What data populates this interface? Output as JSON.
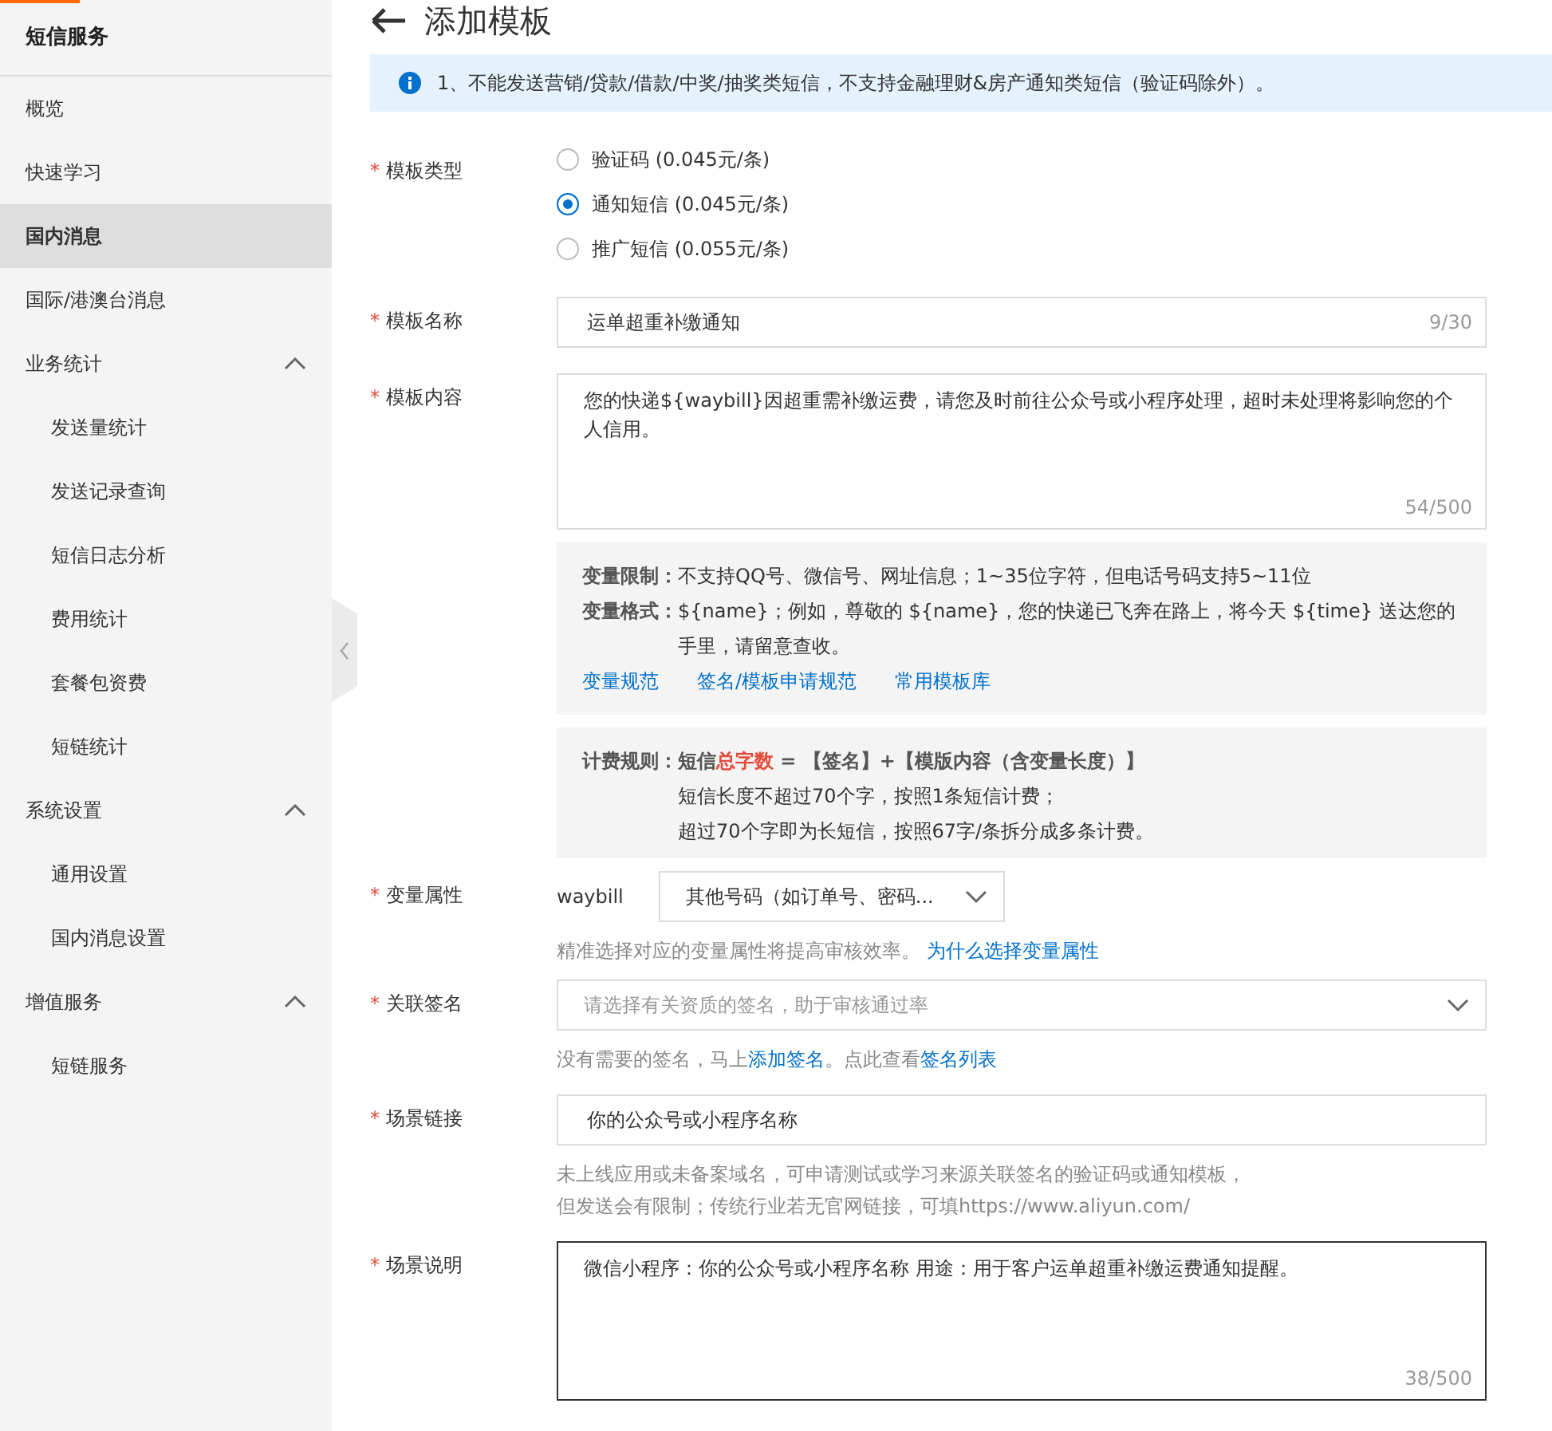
{
  "sidebar": {
    "title": "短信服务",
    "items": [
      {
        "kind": "item",
        "label": "概览",
        "selected": false
      },
      {
        "kind": "item",
        "label": "快速学习",
        "selected": false
      },
      {
        "kind": "item",
        "label": "国内消息",
        "selected": true
      },
      {
        "kind": "item",
        "label": "国际/港澳台消息",
        "selected": false
      },
      {
        "kind": "group",
        "label": "业务统计",
        "expanded": true,
        "children": [
          {
            "label": "发送量统计",
            "selected": false
          },
          {
            "label": "发送记录查询",
            "selected": false
          },
          {
            "label": "短信日志分析",
            "selected": false
          },
          {
            "label": "费用统计",
            "selected": false
          },
          {
            "label": "套餐包资费",
            "selected": false
          },
          {
            "label": "短链统计",
            "selected": false
          }
        ]
      },
      {
        "kind": "group",
        "label": "系统设置",
        "expanded": true,
        "children": [
          {
            "label": "通用设置",
            "selected": false
          },
          {
            "label": "国内消息设置",
            "selected": false
          }
        ]
      },
      {
        "kind": "group",
        "label": "增值服务",
        "expanded": true,
        "children": [
          {
            "label": "短链服务",
            "selected": false
          }
        ]
      }
    ]
  },
  "page": {
    "title": "添加模板",
    "notice": "1、不能发送营销/贷款/借款/中奖/抽奖类短信，不支持金融理财&房产通知类短信（验证码除外）。"
  },
  "form": {
    "template_type": {
      "label": "模板类型",
      "marker": "*",
      "options": [
        {
          "label": "验证码 (0.045元/条)",
          "selected": false
        },
        {
          "label": "通知短信 (0.045元/条)",
          "selected": true
        },
        {
          "label": "推广短信 (0.055元/条)",
          "selected": false
        }
      ]
    },
    "template_name": {
      "label": "模板名称",
      "marker": "*",
      "value": "运单超重补缴通知",
      "counter": "9/30"
    },
    "template_content": {
      "label": "模板内容",
      "marker": "*",
      "value": "您的快递${waybill}因超重需补缴运费，请您及时前往公众号或小程序处理，超时未处理将影响您的个人信用。",
      "counter": "54/500"
    },
    "variable_info": {
      "rules": [
        {
          "term": "变量限制：",
          "text": "不支持QQ号、微信号、网址信息；1~35位字符，但电话号码支持5~11位"
        },
        {
          "term": "变量格式：",
          "text": "${name}；例如，尊敬的 ${name}，您的快递已飞奔在路上，将今天 ${time} 送达您的手里，请留意查收。"
        }
      ],
      "links": [
        "变量规范",
        "签名/模板申请规范",
        "常用模板库"
      ]
    },
    "billing": {
      "term": "计费规则：",
      "prefix": "短信",
      "highlight": "总字数",
      "suffix": " = 【签名】+【模版内容（含变量长度）】",
      "lines": [
        "短信长度不超过70个字，按照1条短信计费；",
        "超过70个字即为长短信，按照67字/条拆分成多条计费。"
      ]
    },
    "variable_attr": {
      "label": "变量属性",
      "marker": "*",
      "variable": "waybill",
      "value": "其他号码（如订单号、密码...",
      "hint": "精准选择对应的变量属性将提高审核效率。",
      "hint_link": "为什么选择变量属性"
    },
    "signature": {
      "label": "关联签名",
      "marker": "*",
      "placeholder": "请选择有关资质的签名，助于审核通过率",
      "hint": [
        {
          "kind": "text",
          "text": "没有需要的签名，马上"
        },
        {
          "kind": "link",
          "text": "添加签名"
        },
        {
          "kind": "text",
          "text": "。点此查看"
        },
        {
          "kind": "link",
          "text": "签名列表"
        }
      ]
    },
    "scene_link": {
      "label": "场景链接",
      "marker": "*",
      "value": "你的公众号或小程序名称",
      "hint": "未上线应用或未备案域名，可申请测试或学习来源关联签名的验证码或通知模板，但发送会有限制；传统行业若无官网链接，可填https://www.aliyun.com/"
    },
    "scene_desc": {
      "label": "场景说明",
      "marker": "*",
      "value": "微信小程序：你的公众号或小程序名称 用途：用于客户运单超重补缴运费通知提醒。",
      "counter": "38/500",
      "focused": true
    }
  }
}
